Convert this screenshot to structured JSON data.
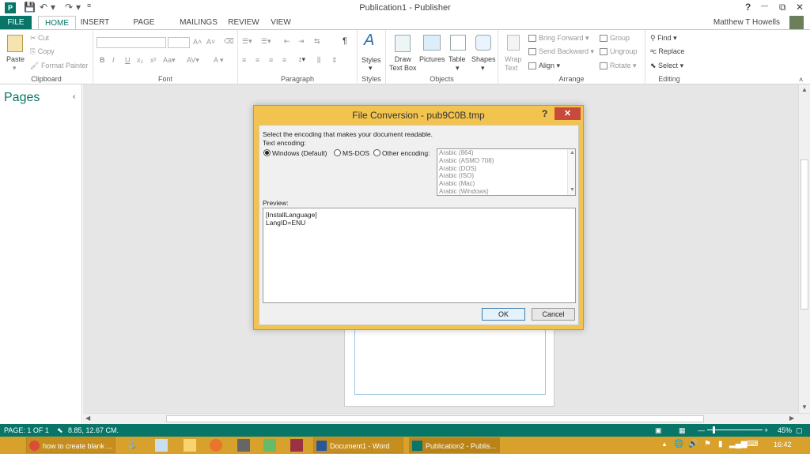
{
  "window": {
    "title": "Publication1 - Publisher",
    "app_icon": "P",
    "help": "?",
    "restore": "⧉",
    "minimize": "—",
    "close": "✕"
  },
  "tabs": [
    {
      "label": "FILE"
    },
    {
      "label": "HOME"
    },
    {
      "label": "INSERT"
    },
    {
      "label": "PAGE DESIGN"
    },
    {
      "label": "MAILINGS"
    },
    {
      "label": "REVIEW"
    },
    {
      "label": "VIEW"
    }
  ],
  "user": {
    "name": "Matthew T Howells"
  },
  "ribbon": {
    "clipboard": {
      "label": "Clipboard",
      "paste": "Paste",
      "cut": "Cut",
      "copy": "Copy",
      "format_painter": "Format Painter"
    },
    "font": {
      "label": "Font"
    },
    "paragraph": {
      "label": "Paragraph"
    },
    "styles": {
      "label": "Styles",
      "button": "Styles"
    },
    "objects": {
      "label": "Objects",
      "draw_text_box": "Draw\nText Box",
      "pictures": "Pictures",
      "table": "Table",
      "shapes": "Shapes"
    },
    "arrange": {
      "label": "Arrange",
      "wrap_text": "Wrap\nText",
      "bring_forward": "Bring Forward",
      "send_backward": "Send Backward",
      "align": "Align",
      "group": "Group",
      "ungroup": "Ungroup",
      "rotate": "Rotate"
    },
    "editing": {
      "label": "Editing",
      "find": "Find",
      "replace": "Replace",
      "select": "Select"
    }
  },
  "pages_pane": {
    "title": "Pages",
    "collapse": "‹"
  },
  "dialog": {
    "title": "File Conversion - pub9C0B.tmp",
    "help": "?",
    "close": "✕",
    "instruction": "Select the encoding that makes your document readable.",
    "encoding_label": "Text encoding:",
    "options": [
      {
        "label": "Windows (Default)",
        "selected": true
      },
      {
        "label": "MS-DOS",
        "selected": false
      },
      {
        "label": "Other encoding:",
        "selected": false
      }
    ],
    "encodings": [
      "Arabic (864)",
      "Arabic (ASMO 708)",
      "Arabic (DOS)",
      "Arabic (ISO)",
      "Arabic (Mac)",
      "Arabic (Windows)"
    ],
    "preview_label": "Preview:",
    "preview_lines": [
      "[InstallLanguage]",
      "LangID=ENU"
    ],
    "ok": "OK",
    "cancel": "Cancel"
  },
  "statusbar": {
    "page": "PAGE: 1 OF 1",
    "position": "8.85, 12.67 CM.",
    "zoom": "45%"
  },
  "taskbar": {
    "items": [
      {
        "label": "how to create blank ..."
      },
      {
        "label": "Document1 - Word"
      },
      {
        "label": "Publication2 - Publis..."
      }
    ],
    "clock": "16:42"
  },
  "colors": {
    "accent": "#077568",
    "taskbar": "#d8a12b",
    "dialog_frame": "#f3c34f",
    "close_red": "#c74a3a"
  }
}
